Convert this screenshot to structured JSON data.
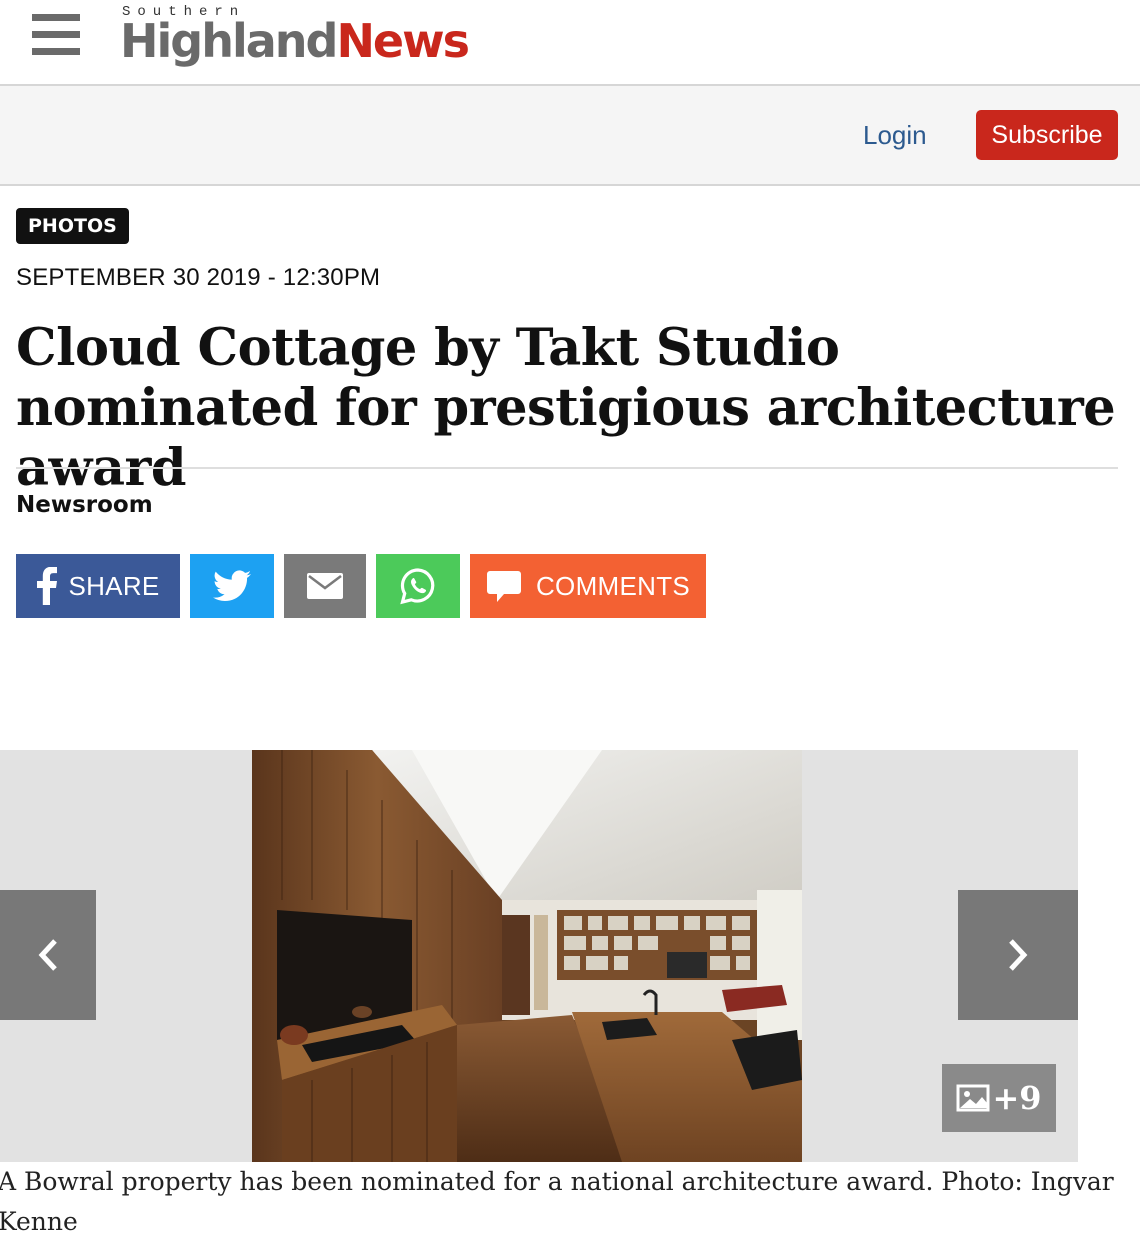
{
  "header": {
    "logo_small": "Southern",
    "logo_highland": "Highland",
    "logo_news": "News"
  },
  "account": {
    "login_label": "Login",
    "subscribe_label": "Subscribe"
  },
  "article": {
    "category": "PHOTOS",
    "date": "SEPTEMBER 30 2019 - 12:30PM",
    "headline": "Cloud Cottage by Takt Studio nominated for prestigious architecture award",
    "author": "Newsroom"
  },
  "share": {
    "facebook_label": "SHARE",
    "comments_label": "COMMENTS"
  },
  "gallery": {
    "more_count": "+9",
    "caption": "A Bowral property has been nominated for a national architecture award. Photo: Ingvar Kenne"
  },
  "colors": {
    "brand_red": "#c9271c",
    "logo_grey": "#6a6a6a",
    "facebook": "#3b5998",
    "twitter": "#1da1f2",
    "email": "#7a7a7a",
    "whatsapp": "#4cca5a",
    "comments": "#f36133",
    "link_blue": "#2c5a8f"
  }
}
